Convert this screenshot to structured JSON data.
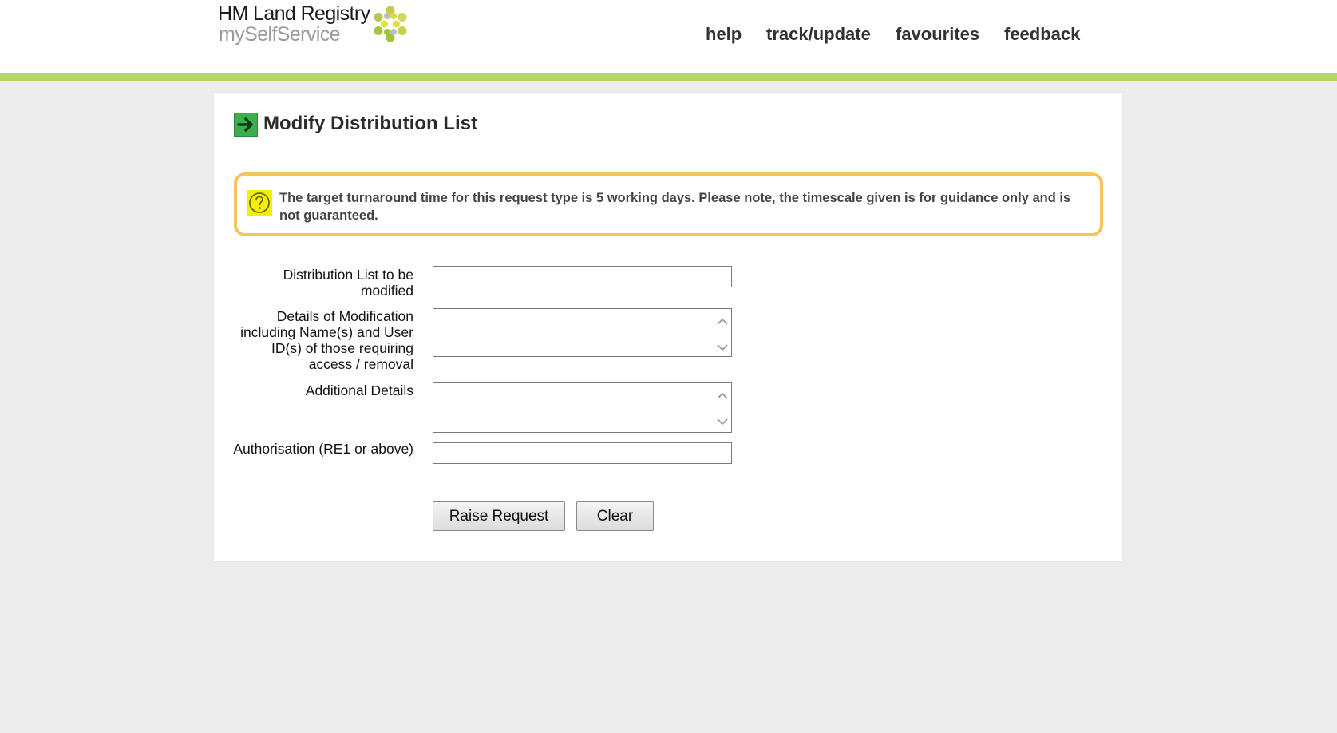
{
  "header": {
    "logo_line1": "HM Land Registry",
    "logo_line2": "mySelfService",
    "nav": [
      {
        "label": "help"
      },
      {
        "label": "track/update"
      },
      {
        "label": "favourites"
      },
      {
        "label": "feedback"
      }
    ]
  },
  "form": {
    "title": "Modify Distribution List",
    "notice": "The target turnaround time for this request type is 5 working days. Please note, the timescale given is for guidance only and is not guaranteed.",
    "fields": [
      {
        "label": "Distribution List to be modified",
        "value": ""
      },
      {
        "label": "Details of Modification including Name(s) and User ID(s) of those requiring access / removal",
        "value": ""
      },
      {
        "label": "Additional Details",
        "value": ""
      },
      {
        "label": "Authorisation (RE1 or above)",
        "value": ""
      }
    ],
    "buttons": {
      "submit": "Raise Request",
      "clear": "Clear"
    }
  },
  "colors": {
    "accent_green": "#b3d569",
    "notice_border": "#f7c35b",
    "title_icon": "#3cae4f"
  },
  "icons": {
    "title": "arrow-right-icon",
    "notice": "question-icon",
    "logo": "flower-icon"
  }
}
